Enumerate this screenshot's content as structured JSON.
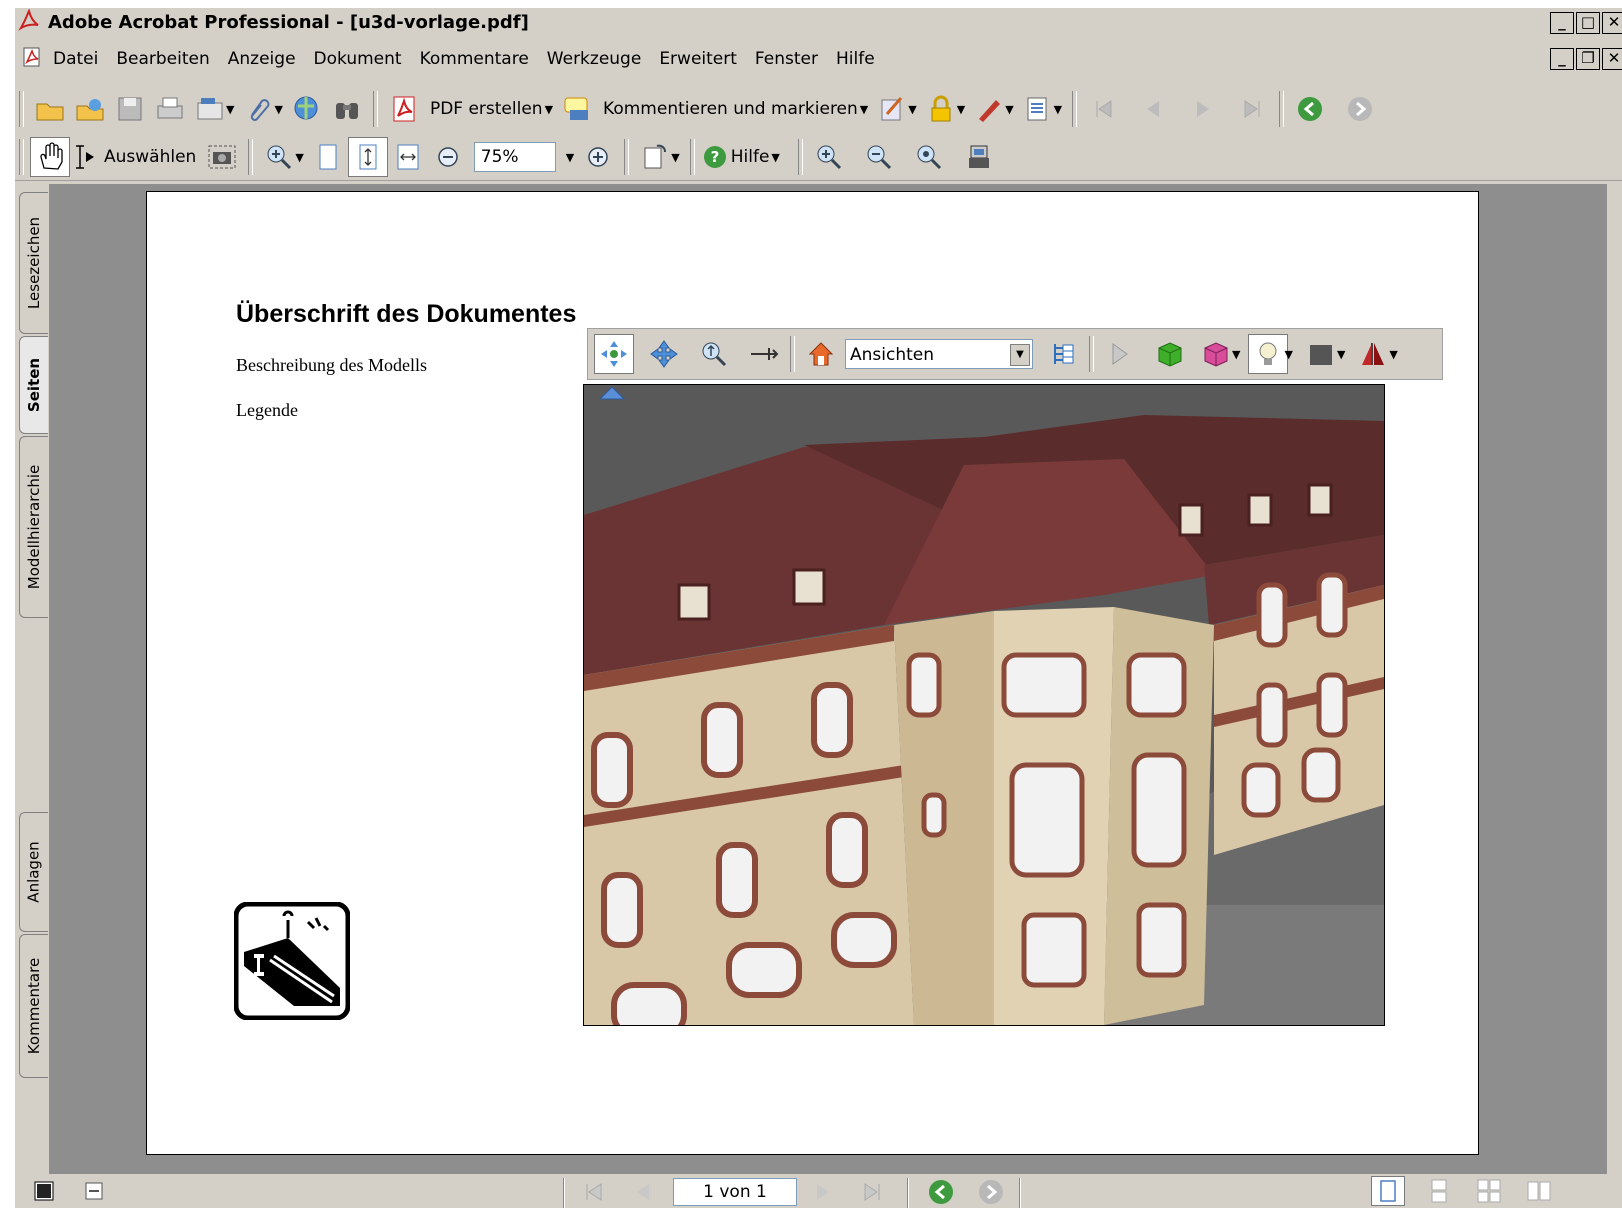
{
  "window": {
    "title": "Adobe Acrobat Professional - [u3d-vorlage.pdf]"
  },
  "menu": [
    "Datei",
    "Bearbeiten",
    "Anzeige",
    "Dokument",
    "Kommentare",
    "Werkzeuge",
    "Erweitert",
    "Fenster",
    "Hilfe"
  ],
  "toolbar": {
    "pdf_erstellen": "PDF erstellen",
    "kommentieren": "Kommentieren und markieren",
    "auswaehlen": "Auswählen",
    "zoom_value": "75%",
    "hilfe": "Hilfe"
  },
  "side_tabs": {
    "lesezeichen": "Lesezeichen",
    "seiten": "Seiten",
    "modellhierarchie": "Modellhierarchie",
    "anlagen": "Anlagen",
    "kommentare": "Kommentare"
  },
  "document": {
    "title": "Überschrift des Dokumentes",
    "description": "Beschreibung des Modells",
    "legend": "Legende"
  },
  "viewer3d": {
    "views_select": "Ansichten"
  },
  "status": {
    "page_indicator": "1 von 1"
  },
  "colors": {
    "chrome": "#d4d0c8",
    "doc_bg": "#8e8e8e",
    "acrobat_red": "#cc1f1f"
  }
}
